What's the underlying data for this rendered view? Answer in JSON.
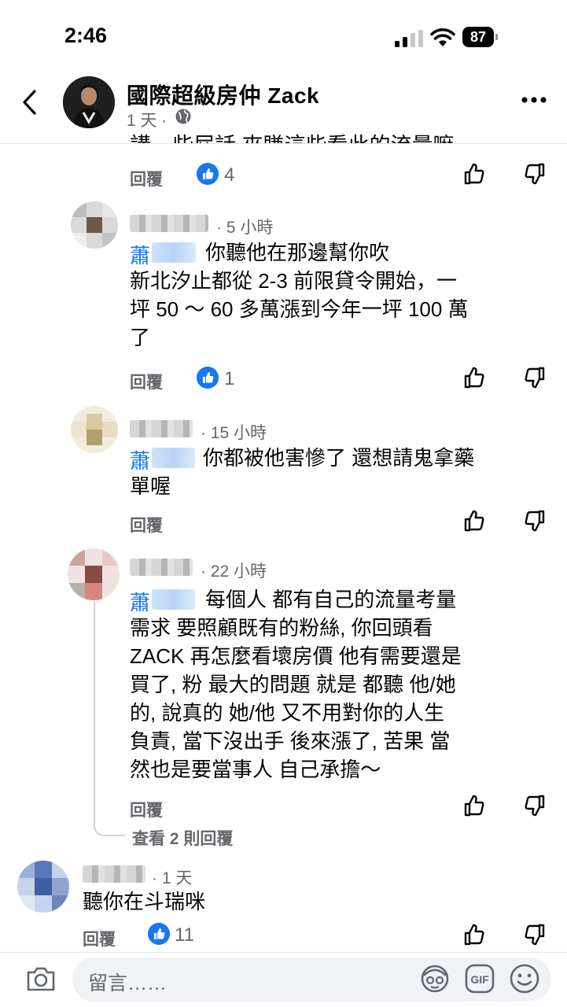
{
  "status_bar": {
    "time": "2:46",
    "battery": "87"
  },
  "header": {
    "page_name": "國際超級房仲 Zack",
    "post_time": "1 天 ·"
  },
  "cut_comment_text": "講一些屁話 來賺這些看此的流量嘛",
  "comments": [
    {
      "reply_label": "回覆",
      "likes": "4"
    },
    {
      "time": "· 5 小時",
      "mention": "蕭",
      "lines": [
        "你聽他在那邊幫你吹",
        "新北汐止都從 2-3 前限貸令開始，一",
        "坪 50 ～ 60 多萬漲到今年一坪 100 萬",
        "了"
      ],
      "reply_label": "回覆",
      "likes": "1"
    },
    {
      "time": "· 15 小時",
      "mention": "蕭",
      "lines": [
        "你都被他害慘了 還想請鬼拿藥",
        "單喔"
      ],
      "reply_label": "回覆"
    },
    {
      "time": "· 22 小時",
      "mention": "蕭",
      "lines": [
        "每個人 都有自己的流量考量",
        "需求 要照顧既有的粉絲, 你回頭看",
        "ZACK 再怎麼看壞房價 他有需要還是",
        "買了, 粉 最大的問題 就是 都聽 他/她",
        "的, 說真的 她/他 又不用對你的人生",
        "負責, 當下沒出手 後來漲了, 苦果 當",
        "然也是要當事人 自己承擔～"
      ],
      "reply_label": "回覆",
      "view_replies": "查看 2 則回覆"
    },
    {
      "time": "· 1 天",
      "lines": [
        "聽你在斗瑞咪"
      ],
      "reply_label": "回覆",
      "likes": "11"
    }
  ],
  "composer": {
    "placeholder": "留言……"
  },
  "icons": {
    "back": "chevron-left-icon",
    "more": "more-horizontal-icon",
    "like": "thumbs-up-icon",
    "dislike": "thumbs-down-icon",
    "camera": "camera-icon",
    "avatar": "avatar-sticker-icon",
    "gif": "gif-icon",
    "emoji": "emoji-icon"
  },
  "colors": {
    "accent": "#1877f2",
    "secondary_text": "#65676b",
    "input_bg": "#f0f2f5"
  }
}
